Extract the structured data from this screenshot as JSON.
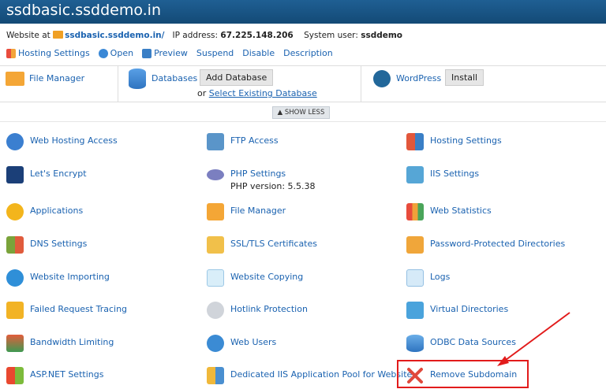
{
  "title": "ssdbasic.ssddemo.in",
  "info": {
    "website_label": "Website at",
    "website_link": "ssdbasic.ssddemo.in/",
    "ip_label": "IP address:",
    "ip_value": "67.225.148.206",
    "user_label": "System user:",
    "user_value": "ssddemo"
  },
  "toolbar": [
    "Hosting Settings",
    "Open",
    "Preview",
    "Suspend",
    "Disable",
    "Description"
  ],
  "top": {
    "file_manager": "File Manager",
    "databases": "Databases",
    "add_database": "Add Database",
    "or_text": "or",
    "select_existing": "Select Existing Database",
    "wordpress": "WordPress",
    "install": "Install"
  },
  "show_less": "▲ SHOW LESS",
  "tools": {
    "col1": [
      "Web Hosting Access",
      "Let's Encrypt",
      "Applications",
      "DNS Settings",
      "Website Importing",
      "Failed Request Tracing",
      "Bandwidth Limiting",
      "ASP.NET Settings"
    ],
    "col2": [
      "FTP Access",
      "PHP Settings",
      "File Manager",
      "SSL/TLS Certificates",
      "Website Copying",
      "Hotlink Protection",
      "Web Users",
      "Dedicated IIS Application Pool for Website"
    ],
    "col3": [
      "Hosting Settings",
      "IIS Settings",
      "Web Statistics",
      "Password-Protected Directories",
      "Logs",
      "Virtual Directories",
      "ODBC Data Sources",
      "Remove Subdomain"
    ]
  },
  "php_version": "PHP version: 5.5.38",
  "colors": {
    "titlebar": "#1a5688",
    "link": "#1a62b0",
    "highlight": "#e21b1b"
  }
}
